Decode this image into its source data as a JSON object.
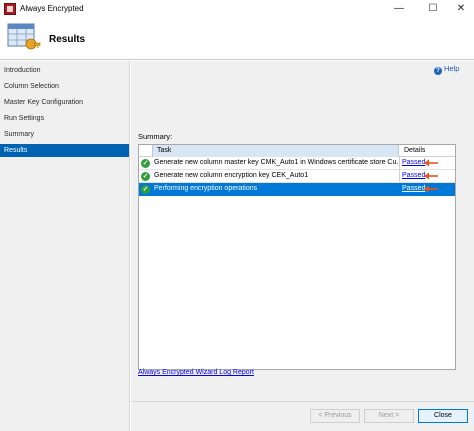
{
  "window": {
    "title": "Always Encrypted",
    "controls": {
      "minimize": "—",
      "maximize": "☐",
      "close": "✕"
    }
  },
  "header": {
    "title": "Results",
    "icon": "wizard-icon"
  },
  "sidebar": {
    "items": [
      {
        "label": "Introduction",
        "active": false
      },
      {
        "label": "Column Selection",
        "active": false
      },
      {
        "label": "Master Key Configuration",
        "active": false
      },
      {
        "label": "Run Settings",
        "active": false
      },
      {
        "label": "Summary",
        "active": false
      },
      {
        "label": "Results",
        "active": true
      }
    ]
  },
  "help": {
    "label": "Help",
    "icon_glyph": "?"
  },
  "summary": {
    "label": "Summary:",
    "columns": {
      "task": "Task",
      "details": "Details"
    },
    "rows": [
      {
        "status": "success",
        "status_glyph": "✓",
        "task": "Generate new column master key CMK_Auto1 in Windows certificate store Cu...",
        "details": "Passed",
        "selected": false
      },
      {
        "status": "success",
        "status_glyph": "✓",
        "task": "Generate new column encryption key CEK_Auto1",
        "details": "Passed",
        "selected": false
      },
      {
        "status": "success",
        "status_glyph": "✓",
        "task": "Performing encryption operations",
        "details": "Passed",
        "selected": true
      }
    ]
  },
  "log_link": "Always Encrypted Wizard Log Report",
  "footer": {
    "previous": "< Previous",
    "next": "Next >",
    "close": "Close"
  },
  "colors": {
    "accent": "#0078d7",
    "sidebar_active": "#0063b1",
    "success": "#2e9d3a",
    "annotation_arrow": "#e8541e",
    "link": "#0000ee"
  }
}
